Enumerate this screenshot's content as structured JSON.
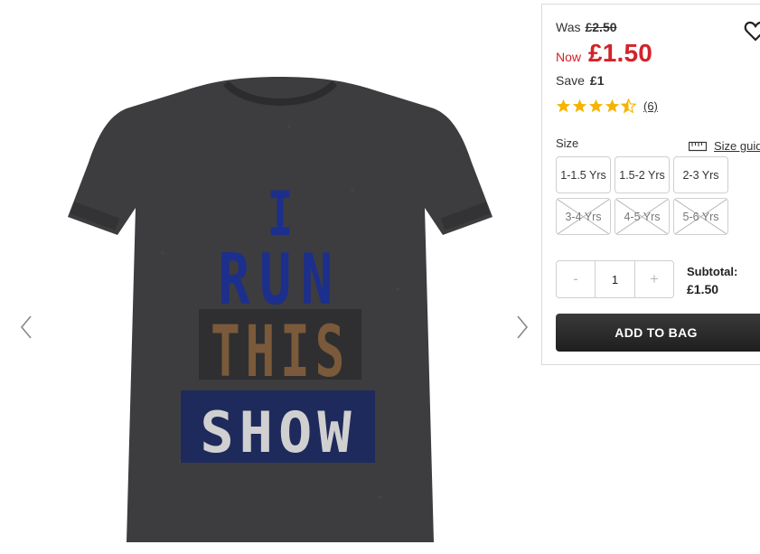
{
  "gallery": {
    "prev_icon": "chevron-left-icon",
    "next_icon": "chevron-right-icon",
    "graphic": {
      "line1": "I",
      "line2": "RUN",
      "line3": "THIS",
      "line4": "SHOW"
    }
  },
  "pricing": {
    "was_label": "Was",
    "was_price": "£2.50",
    "now_label": "Now",
    "now_price": "£1.50",
    "save_label": "Save",
    "save_amount": "£1"
  },
  "rating": {
    "stars": 4.5,
    "max_stars": 5,
    "review_count": "(6)",
    "star_color": "#f5b400"
  },
  "size": {
    "label": "Size",
    "guide_label": "Size guide",
    "options": [
      {
        "label": "1-1.5 Yrs",
        "available": true
      },
      {
        "label": "1.5-2 Yrs",
        "available": true
      },
      {
        "label": "2-3 Yrs",
        "available": true
      },
      {
        "label": "3-4 Yrs",
        "available": false
      },
      {
        "label": "4-5 Yrs",
        "available": false
      },
      {
        "label": "5-6 Yrs",
        "available": false
      }
    ]
  },
  "quantity": {
    "minus": "-",
    "value": "1",
    "plus": "+"
  },
  "subtotal": {
    "label": "Subtotal:",
    "amount": "£1.50"
  },
  "cta": {
    "add_to_bag": "ADD TO BAG"
  },
  "colors": {
    "sale_red": "#d2232a",
    "button_dark": "#2a2a2a",
    "tshirt": "#3d3d3f",
    "print_blue": "#1c2f8c"
  }
}
